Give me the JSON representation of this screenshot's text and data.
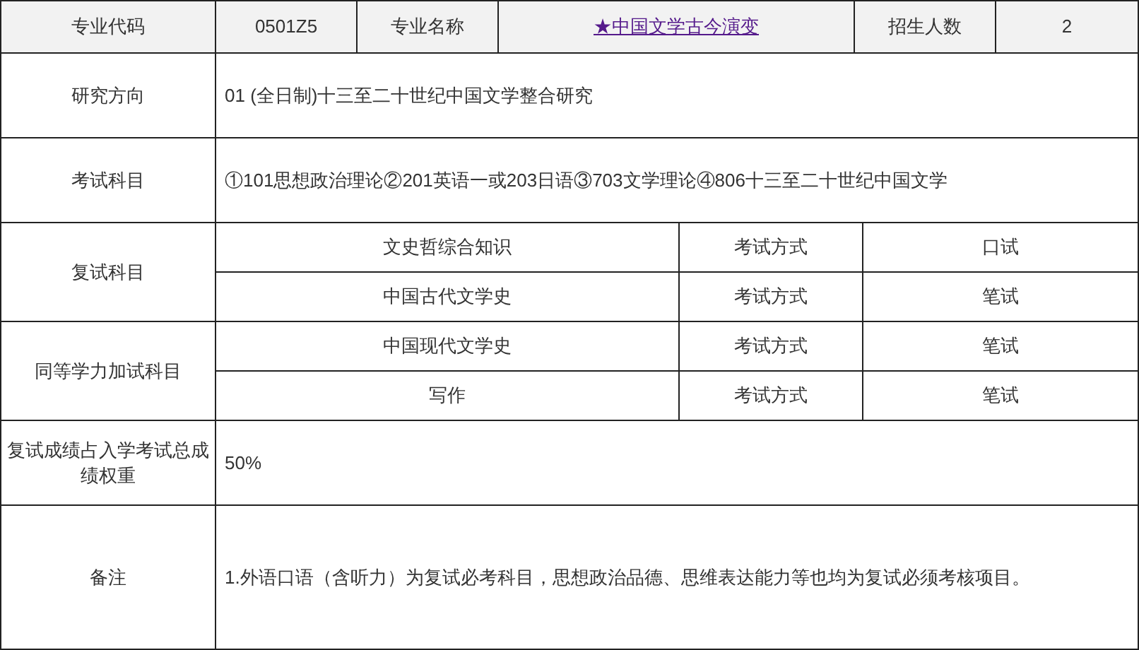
{
  "header": {
    "code_label": "专业代码",
    "code": "0501Z5",
    "name_label": "专业名称",
    "name": "★中国文学古今演变",
    "quota_label": "招生人数",
    "quota": "2"
  },
  "rows": [
    {
      "kind": "text",
      "label": "研究方向",
      "value": "01 (全日制)十三至二十世纪中国文学整合研究"
    },
    {
      "kind": "text",
      "label": "考试科目",
      "value": "①101思想政治理论②201英语一或203日语③703文学理论④806十三至二十世纪中国文学"
    },
    {
      "kind": "subjects",
      "label": "复试科目",
      "subjects": [
        {
          "subject": "文史哲综合知识",
          "method_label": "考试方式",
          "method": "口试"
        },
        {
          "subject": "中国古代文学史",
          "method_label": "考试方式",
          "method": "笔试"
        }
      ]
    },
    {
      "kind": "subjects",
      "label": "同等学力加试科目",
      "subjects": [
        {
          "subject": "中国现代文学史",
          "method_label": "考试方式",
          "method": "笔试"
        },
        {
          "subject": "写作",
          "method_label": "考试方式",
          "method": "笔试"
        }
      ]
    },
    {
      "kind": "text",
      "label": "复试成绩占入学考试总成绩权重",
      "value": "50%"
    },
    {
      "kind": "note",
      "label": "备注",
      "value": "1.外语口语（含听力）为复试必考科目，思想政治品德、思维表达能力等也均为复试必须考核项目。"
    }
  ]
}
